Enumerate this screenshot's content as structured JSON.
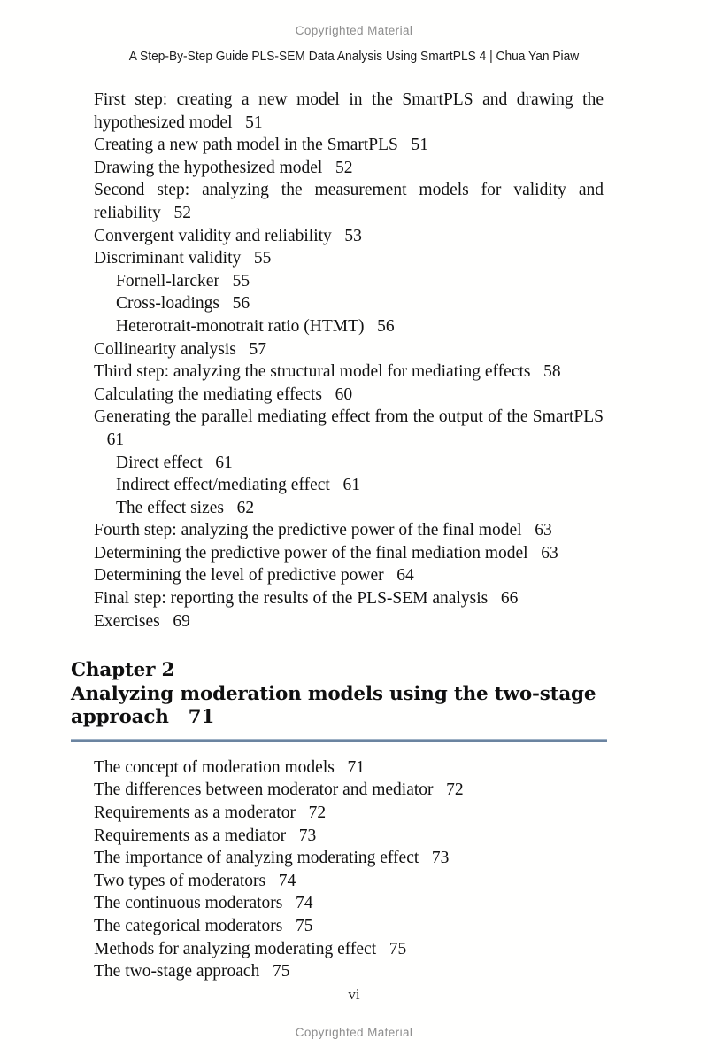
{
  "page": {
    "watermark_top": "Copyrighted Material",
    "watermark_bottom": "Copyrighted Material",
    "running_head": "A Step-By-Step Guide PLS-SEM Data Analysis Using SmartPLS 4 | Chua Yan Piaw",
    "folio": "vi",
    "rule_color": "#6b84a0",
    "watermark_color": "#8d8d8d",
    "text_color": "#111111"
  },
  "toc": {
    "section_one": [
      {
        "level": 0,
        "title": "First step: creating a new model in the SmartPLS and drawing the hypothesized model",
        "page": "51"
      },
      {
        "level": 1,
        "title": "Creating a new path model in the SmartPLS",
        "page": "51"
      },
      {
        "level": 1,
        "title": "Drawing the hypothesized model",
        "page": "52"
      },
      {
        "level": 0,
        "title": "Second step: analyzing the measurement models for validity and reliability",
        "page": "52"
      },
      {
        "level": 1,
        "title": "Convergent validity and reliability",
        "page": "53"
      },
      {
        "level": 1,
        "title": "Discriminant validity",
        "page": "55"
      },
      {
        "level": 2,
        "title": "Fornell-larcker",
        "page": "55"
      },
      {
        "level": 2,
        "title": "Cross-loadings",
        "page": "56"
      },
      {
        "level": 2,
        "title": "Heterotrait-monotrait ratio (HTMT)",
        "page": "56"
      },
      {
        "level": 1,
        "title": "Collinearity analysis",
        "page": "57"
      },
      {
        "level": 0,
        "title": "Third step: analyzing the structural model for mediating effects",
        "page": "58"
      },
      {
        "level": 1,
        "title": "Calculating the mediating effects",
        "page": "60"
      },
      {
        "level": 1,
        "title": "Generating the parallel mediating effect from the output of the SmartPLS",
        "page": "61"
      },
      {
        "level": 2,
        "title": "Direct effect",
        "page": "61"
      },
      {
        "level": 2,
        "title": "Indirect effect/mediating effect",
        "page": "61"
      },
      {
        "level": 2,
        "title": "The effect sizes",
        "page": "62"
      },
      {
        "level": 0,
        "title": "Fourth step: analyzing the predictive power of the final model",
        "page": "63"
      },
      {
        "level": 1,
        "title": "Determining the predictive power of the final mediation model",
        "page": "63"
      },
      {
        "level": 1,
        "title": "Determining the level of predictive power",
        "page": "64"
      },
      {
        "level": 0,
        "title": "Final step: reporting the results of the PLS-SEM analysis",
        "page": "66"
      },
      {
        "level": 0,
        "title": "Exercises",
        "page": "69"
      }
    ],
    "chapter": {
      "number_label": "Chapter 2",
      "title": "Analyzing moderation models using the two-stage approach",
      "page": "71"
    },
    "section_two": [
      {
        "level": 0,
        "title": "The concept of moderation models",
        "page": "71"
      },
      {
        "level": 0,
        "title": "The differences between moderator and mediator",
        "page": "72"
      },
      {
        "level": 0,
        "title": "Requirements as a moderator",
        "page": "72"
      },
      {
        "level": 0,
        "title": "Requirements as a mediator",
        "page": "73"
      },
      {
        "level": 0,
        "title": "The importance of analyzing moderating effect",
        "page": "73"
      },
      {
        "level": 0,
        "title": "Two types of moderators",
        "page": "74"
      },
      {
        "level": 1,
        "title": "The continuous moderators",
        "page": "74"
      },
      {
        "level": 1,
        "title": "The categorical moderators",
        "page": "75"
      },
      {
        "level": 0,
        "title": "Methods for analyzing moderating effect",
        "page": "75"
      },
      {
        "level": 1,
        "title": "The two-stage approach",
        "page": "75"
      }
    ]
  }
}
